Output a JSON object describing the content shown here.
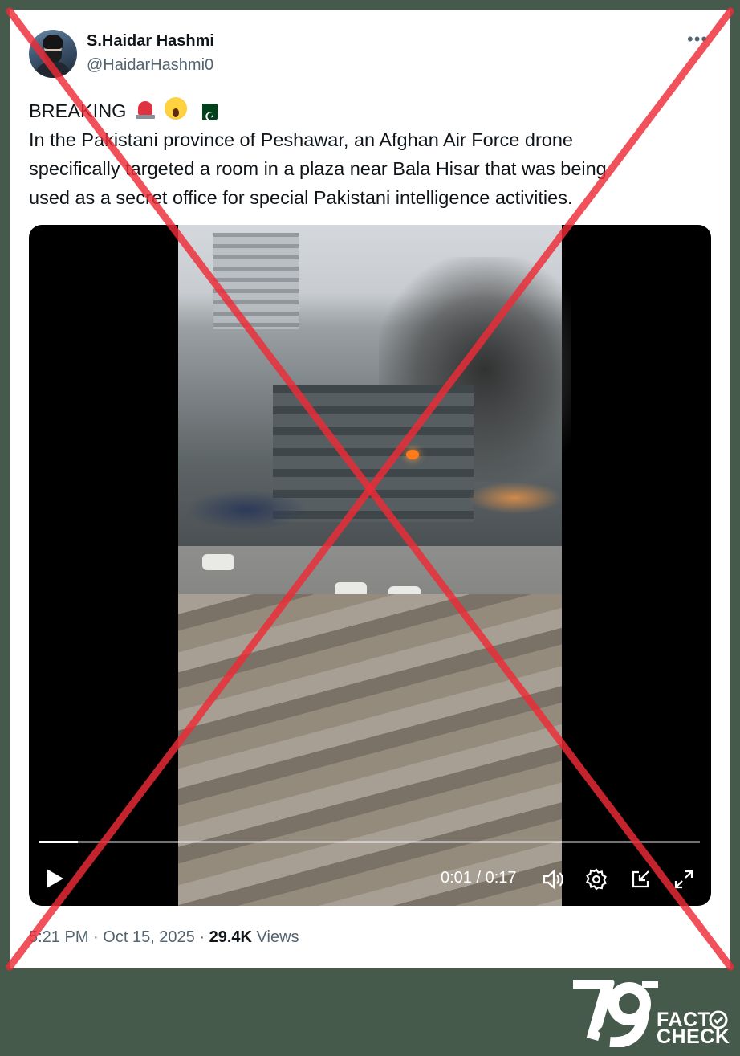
{
  "tweet": {
    "display_name": "S.Haidar Hashmi",
    "handle": "@HaidarHashmi0",
    "more_icon": "more-horizontal-icon",
    "text_lines": [
      "BREAKING",
      "In the Pakistani province of Peshawar, an Afghan Air Force drone",
      "specifically targeted a room in a plaza near Bala Hisar that was being",
      "used as a secret office for special Pakistani intelligence activities."
    ],
    "emojis": [
      "rotating-light-emoji",
      "screaming-face-emoji",
      "pakistan-flag-emoji"
    ],
    "time": "5:21 PM",
    "separator": "·",
    "date": "Oct 15, 2025",
    "views_count": "29.4K",
    "views_label": "Views"
  },
  "video": {
    "current_time": "0:01",
    "separator": "/",
    "duration": "0:17",
    "progress_fraction": 0.06,
    "controls": [
      "play-icon",
      "volume-icon",
      "settings-icon",
      "pip-icon",
      "fullscreen-icon"
    ]
  },
  "overlay": {
    "cross_color": "#ee2b36",
    "meaning": "cross-mark-overlay"
  },
  "branding": {
    "logo_number": "79",
    "word1": "FACT",
    "word2": "CHECK",
    "background": "#465a4b"
  }
}
